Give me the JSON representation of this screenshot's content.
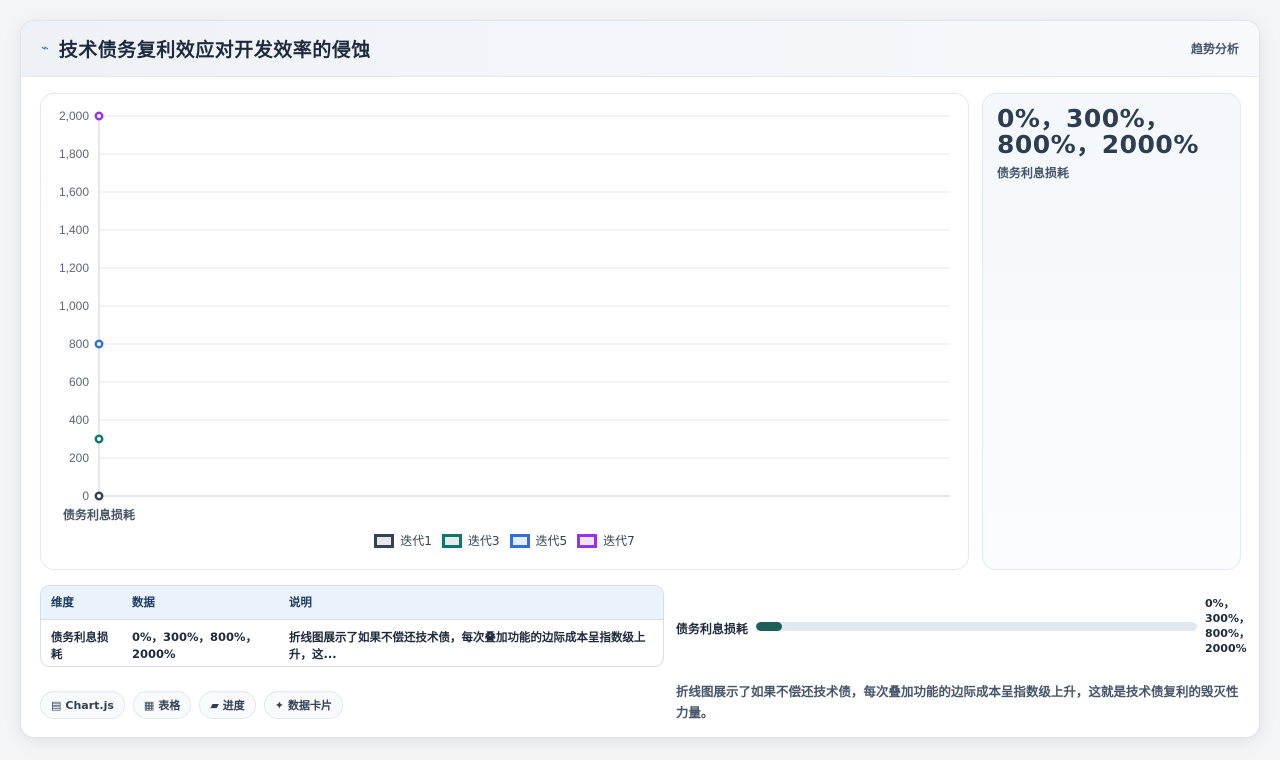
{
  "header": {
    "title": "技术债务复利效应对开发效率的侵蚀",
    "tag": "趋势分析",
    "icon": "trend-icon"
  },
  "chart_data": {
    "type": "line",
    "categories": [
      "债务利息损耗"
    ],
    "series": [
      {
        "name": "迭代1",
        "values": [
          0
        ],
        "color": "#334155"
      },
      {
        "name": "迭代3",
        "values": [
          300
        ],
        "color": "#0f766e"
      },
      {
        "name": "迭代5",
        "values": [
          800
        ],
        "color": "#2f6fd6"
      },
      {
        "name": "迭代7",
        "values": [
          2000
        ],
        "color": "#9333ea"
      }
    ],
    "yticks": [
      "0",
      "200",
      "400",
      "600",
      "800",
      "1,000",
      "1,200",
      "1,400",
      "1,600",
      "1,800",
      "2,000"
    ],
    "ylim": [
      0,
      2000
    ],
    "grid": true,
    "legend": "bottom"
  },
  "stat": {
    "value": "0%，300%，800%，2000%",
    "label": "债务利息损耗"
  },
  "table": {
    "headers": [
      "维度",
      "数据",
      "说明"
    ],
    "rows": [
      {
        "dimension": "债务利息损耗",
        "data": "0%，300%，800%，2000%",
        "note": "折线图展示了如果不偿还技术债，每次叠加功能的边际成本呈指数级上升，这..."
      }
    ]
  },
  "chips": [
    {
      "icon": "chart-icon",
      "glyph": "▤",
      "label": "Chart.js"
    },
    {
      "icon": "table-icon",
      "glyph": "▦",
      "label": "表格"
    },
    {
      "icon": "progress-icon",
      "glyph": "▰",
      "label": "进度"
    },
    {
      "icon": "card-icon",
      "glyph": "✦",
      "label": "数据卡片"
    }
  ],
  "progress": {
    "label": "债务利息损耗",
    "value_text": "0%，300%，800%，2000%",
    "fraction": 0.06,
    "color": "#1f5f5b"
  },
  "description": "折线图展示了如果不偿还技术债，每次叠加功能的边际成本呈指数级上升，这就是技术债复利的毁灭性力量。"
}
